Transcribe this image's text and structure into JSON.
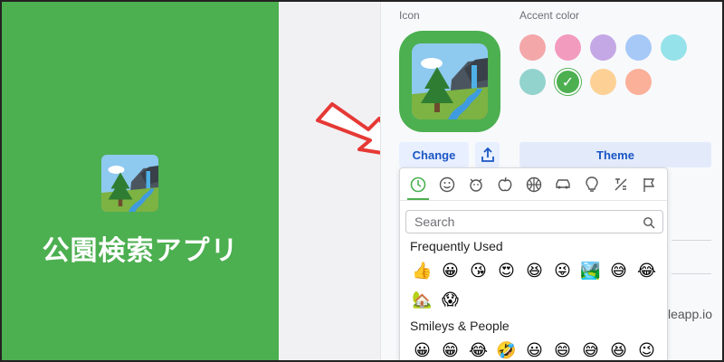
{
  "app": {
    "title": "公園検索アプリ"
  },
  "settings": {
    "icon_label": "Icon",
    "accent_label": "Accent color",
    "change_label": "Change",
    "theme_label": "Theme",
    "upload_icon": "upload-icon",
    "accent_colors": [
      "#f4a7a9",
      "#f29bbf",
      "#c4a8e5",
      "#a7c9f7",
      "#95e2ea",
      "#93d3ce",
      "#4caf50",
      "#fdd195",
      "#fbb09a"
    ],
    "selected_color": "#4caf50",
    "selected_mark": "✓",
    "url_fragment": "leapp.io"
  },
  "picker": {
    "categories": [
      "recent-icon",
      "smiley-icon",
      "animal-icon",
      "food-icon",
      "sports-icon",
      "travel-icon",
      "objects-icon",
      "symbols-icon",
      "flags-icon"
    ],
    "search_placeholder": "Search",
    "sections": [
      {
        "title": "Frequently Used",
        "rows": [
          [
            "👍",
            "😀",
            "😘",
            "😍",
            "😆",
            "😜",
            "🏞️",
            "😅",
            "😂"
          ],
          [
            "🏡",
            "😱"
          ]
        ]
      },
      {
        "title": "Smileys & People",
        "rows": [
          [
            "😀",
            "😁",
            "😂",
            "🤣",
            "😃",
            "😄",
            "😅",
            "😆",
            "😉"
          ]
        ]
      }
    ]
  }
}
